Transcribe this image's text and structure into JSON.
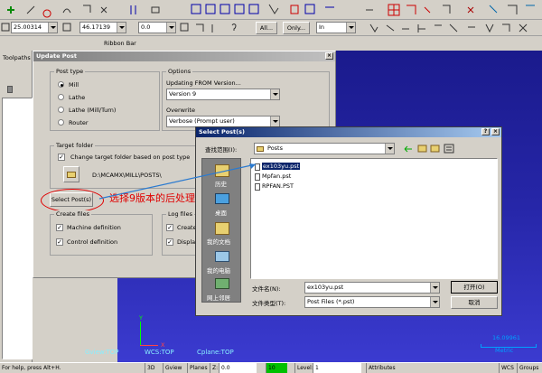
{
  "toolbar_top": {
    "inputs": [
      "25.00314",
      "46.17139",
      "0.0"
    ],
    "all_button": "All...",
    "only_button": "Only...",
    "in_select": "In"
  },
  "ribbon_label": "Ribbon Bar",
  "toolpaths_tab": "Toolpaths",
  "update_post": {
    "title": "Update Post",
    "post_type_title": "Post type",
    "post_types": [
      "Mill",
      "Lathe",
      "Lathe (Mill/Turn)",
      "Router"
    ],
    "selected_post_type": "Mill",
    "options_title": "Options",
    "updating_from_label": "Updating FROM Version...",
    "updating_from_value": "Version 9",
    "overwrite_label": "Overwrite",
    "overwrite_value": "Verbose (Prompt user)",
    "target_folder_title": "Target folder",
    "change_target_label": "Change target folder based on post type",
    "target_path": "D:\\MCAMX\\MILL\\POSTS\\",
    "select_posts_button": "Select Post(s)",
    "annotation": "选择9版本的后处理",
    "create_files_title": "Create files",
    "machine_definition": "Machine definition",
    "control_definition": "Control definition",
    "log_files_title": "Log files",
    "log_create": "Create",
    "log_display": "Display"
  },
  "select_post_dialog": {
    "title": "Select Post(s)",
    "look_in_label": "查找范围(I):",
    "look_in_value": "Posts",
    "places": [
      "历史",
      "桌面",
      "我的文档",
      "我的电脑",
      "网上邻居"
    ],
    "files": [
      "ex103yu.pst",
      "Mpfan.pst",
      "RPFAN.PST"
    ],
    "selected_file": "ex103yu.pst",
    "filename_label": "文件名(N):",
    "filename_value": "ex103yu.pst",
    "filetype_label": "文件类型(T):",
    "filetype_value": "Post Files (*.pst)",
    "open_button": "打开(O)",
    "cancel_button": "取消"
  },
  "viewport": {
    "gview": "Gview:TOP",
    "wcs": "WCS:TOP",
    "cplane": "Cplane:TOP",
    "scale_value": "16.09961",
    "scale_unit": "Metric",
    "axis_x": "X",
    "axis_y": "Y"
  },
  "status_bar": {
    "help": "For help, press Alt+H.",
    "items": [
      "3D",
      "Gview",
      "Planes",
      "Z:",
      "0.0",
      "10",
      "Level:",
      "1",
      "Attributes",
      "WCS",
      "Groups"
    ]
  },
  "colors": {
    "viewport_top": "#1a1a8c",
    "viewport_bottom": "#3b3bd0",
    "titlebar": "#0a246a",
    "annotation": "#e00000",
    "scale": "#00a0ff"
  }
}
